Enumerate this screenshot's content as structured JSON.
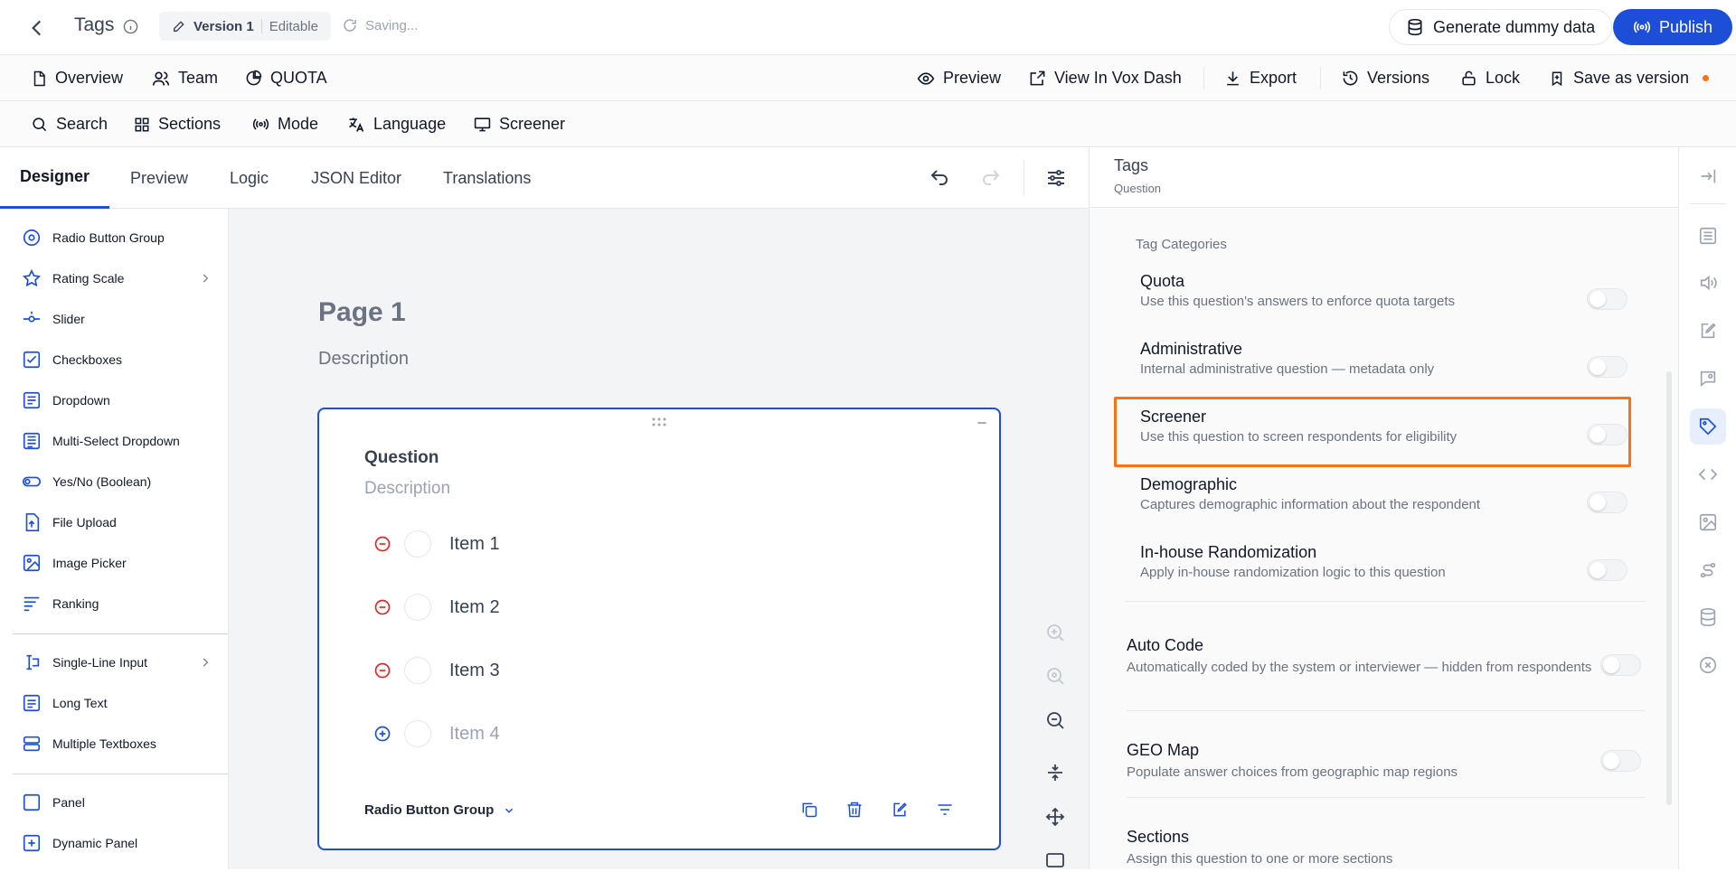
{
  "topbar": {
    "title": "Tags",
    "version_label": "Version 1",
    "version_mode": "Editable",
    "saving_text": "Saving...",
    "generate_label": "Generate dummy data",
    "publish_label": "Publish"
  },
  "nav": {
    "overview": "Overview",
    "team": "Team",
    "quota": "QUOTA",
    "preview": "Preview",
    "view_dash": "View In Vox Dash",
    "export": "Export",
    "versions": "Versions",
    "lock": "Lock",
    "save_version": "Save as version"
  },
  "tools": {
    "search": "Search",
    "sections": "Sections",
    "mode": "Mode",
    "language": "Language",
    "screener": "Screener"
  },
  "tabs": [
    "Designer",
    "Preview",
    "Logic",
    "JSON Editor",
    "Translations"
  ],
  "toolbox": {
    "items": [
      {
        "label": "Radio Button Group",
        "icon": "radio-icon"
      },
      {
        "label": "Rating Scale",
        "icon": "star-icon"
      },
      {
        "label": "Slider",
        "icon": "slider-icon"
      },
      {
        "label": "Checkboxes",
        "icon": "checkbox-icon"
      },
      {
        "label": "Dropdown",
        "icon": "dropdown-icon"
      },
      {
        "label": "Multi-Select Dropdown",
        "icon": "multiselect-icon"
      },
      {
        "label": "Yes/No (Boolean)",
        "icon": "toggle-icon"
      },
      {
        "label": "File Upload",
        "icon": "upload-icon"
      },
      {
        "label": "Image Picker",
        "icon": "image-icon"
      },
      {
        "label": "Ranking",
        "icon": "ranking-icon"
      },
      {
        "label": "Single-Line Input",
        "icon": "text-cursor-icon"
      },
      {
        "label": "Long Text",
        "icon": "long-text-icon"
      },
      {
        "label": "Multiple Textboxes",
        "icon": "textboxes-icon"
      },
      {
        "label": "Panel",
        "icon": "panel-icon"
      },
      {
        "label": "Dynamic Panel",
        "icon": "dynamic-panel-icon"
      }
    ]
  },
  "canvas": {
    "page_title": "Page 1",
    "page_description": "Description",
    "question": {
      "title": "Question",
      "description": "Description",
      "choices": [
        "Item 1",
        "Item 2",
        "Item 3"
      ],
      "add_choice": "Item 4",
      "type_label": "Radio Button Group"
    }
  },
  "props": {
    "title": "Tags",
    "subtitle": "Question",
    "tag_categories_label": "Tag Categories",
    "tags": [
      {
        "title": "Quota",
        "desc": "Use this question's answers to enforce quota targets",
        "on": false
      },
      {
        "title": "Administrative",
        "desc": "Internal administrative question — metadata only",
        "on": false
      },
      {
        "title": "Screener",
        "desc": "Use this question to screen respondents for eligibility",
        "on": false
      },
      {
        "title": "Demographic",
        "desc": "Captures demographic information about the respondent",
        "on": false
      },
      {
        "title": "In-house Randomization",
        "desc": "Apply in-house randomization logic to this question",
        "on": false
      }
    ],
    "auto_code": {
      "title": "Auto Code",
      "desc": "Automatically coded by the system or interviewer — hidden from respondents"
    },
    "geo_map": {
      "title": "GEO Map",
      "desc": "Populate answer choices from geographic map regions"
    },
    "sections": {
      "title": "Sections",
      "desc": "Assign this question to one or more sections"
    }
  },
  "colors": {
    "accent": "#1d4ed8",
    "highlight": "#f97316",
    "danger": "#dc2626"
  }
}
